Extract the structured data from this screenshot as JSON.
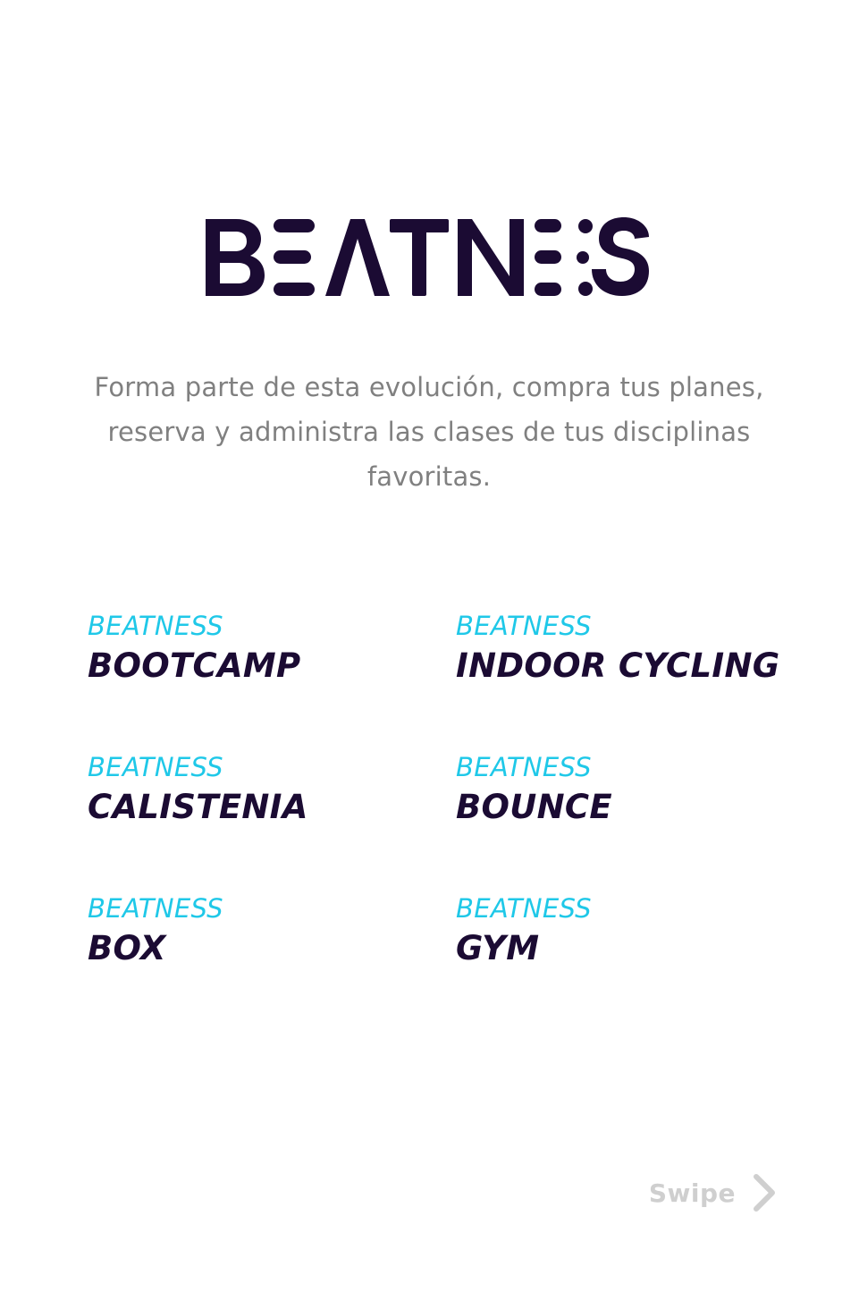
{
  "logo": {
    "text": "BEATNESS",
    "color": "#1b0b33"
  },
  "tagline": "Forma parte de esta evolución, compra tus planes, reserva y administra las clases de tus disciplinas favoritas.",
  "disciplines": [
    {
      "brand": "BEATNESS",
      "name": "BOOTCAMP"
    },
    {
      "brand": "BEATNESS",
      "name": "INDOOR CYCLING"
    },
    {
      "brand": "BEATNESS",
      "name": "CALISTENIA"
    },
    {
      "brand": "BEATNESS",
      "name": "BOUNCE"
    },
    {
      "brand": "BEATNESS",
      "name": "BOX"
    },
    {
      "brand": "BEATNESS",
      "name": "GYM"
    }
  ],
  "swipe": {
    "label": "Swipe",
    "icon": "chevron-right-icon"
  },
  "colors": {
    "accent": "#1fc8e8",
    "dark": "#1b0b33",
    "muted_text": "#808080",
    "swipe": "#cfcfcf"
  }
}
